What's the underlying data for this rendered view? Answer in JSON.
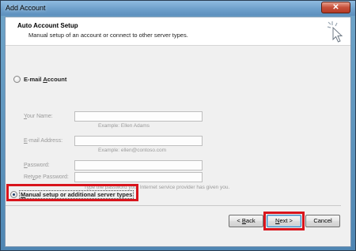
{
  "window": {
    "title": "Add Account",
    "close_glyph": "✕"
  },
  "header": {
    "title": "Auto Account Setup",
    "subtitle": "Manual setup of an account or connect to other server types.",
    "icon": "cursor-sparkle-icon"
  },
  "options": {
    "email_account": {
      "label_pre": "E-mail ",
      "label_key": "A",
      "label_post": "ccount",
      "checked": false
    },
    "manual_setup": {
      "label_key": "M",
      "label_post": "anual setup or additional server types",
      "checked": true
    }
  },
  "fields": {
    "name": {
      "label_key": "Y",
      "label_post": "our Name:",
      "value": "",
      "hint": "Example: Ellen Adams"
    },
    "email": {
      "label_key": "E",
      "label_post": "-mail Address:",
      "value": "",
      "hint": "Example: ellen@contoso.com"
    },
    "password": {
      "label_key": "P",
      "label_post": "assword:",
      "value": ""
    },
    "retype": {
      "label_pre": "Ret",
      "label_key": "y",
      "label_post": "pe Password:",
      "value": "",
      "hint": "Type the password your Internet service provider has given you."
    }
  },
  "buttons": {
    "back": {
      "pre": "< ",
      "key": "B",
      "post": "ack"
    },
    "next": {
      "key": "N",
      "post": "ext >"
    },
    "cancel": {
      "label": "Cancel"
    }
  },
  "colors": {
    "highlight_red": "#d8141c",
    "title_bar": "#6ea0cb"
  }
}
